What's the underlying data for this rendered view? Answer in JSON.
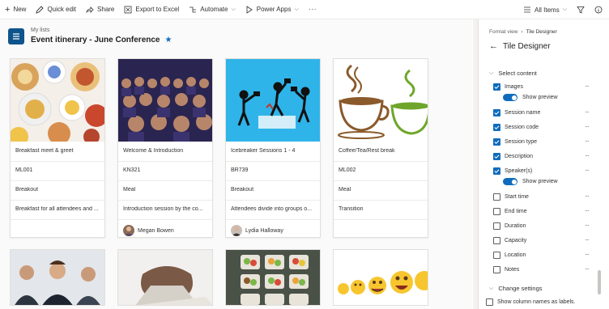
{
  "toolbar": {
    "new": "New",
    "quick_edit": "Quick edit",
    "share": "Share",
    "export": "Export to Excel",
    "automate": "Automate",
    "power_apps": "Power Apps",
    "more": "···",
    "view": "All Items"
  },
  "header": {
    "breadcrumb": "My lists",
    "title": "Event itinerary - June Conference"
  },
  "cards": [
    {
      "name": "Breakfast meet & greet",
      "code": "ML001",
      "type": "Breakout",
      "description": "Breakfast for all attendees and ...",
      "speaker": ""
    },
    {
      "name": "Welcome & Introduction",
      "code": "KN321",
      "type": "Meal",
      "description": "Introduction session by the co...",
      "speaker": "Megan Bowen"
    },
    {
      "name": "Icebreaker Sessions 1 - 4",
      "code": "BR739",
      "type": "Breakout",
      "description": "Attendees divide into groups o...",
      "speaker": "Lydia Halloway"
    },
    {
      "name": "Coffee/Tea/Rest break",
      "code": "ML002",
      "type": "Meal",
      "description": "Transition",
      "speaker": ""
    }
  ],
  "panel": {
    "breadcrumb_parent": "Format view",
    "breadcrumb_current": "Tile Designer",
    "title": "Tile Designer",
    "select_content": "Select content",
    "show_preview": "Show preview",
    "fields": [
      {
        "label": "Images",
        "checked": true
      },
      {
        "label": "Session name",
        "checked": true
      },
      {
        "label": "Session code",
        "checked": true
      },
      {
        "label": "Session type",
        "checked": true
      },
      {
        "label": "Description",
        "checked": true
      },
      {
        "label": "Speaker(s)",
        "checked": true
      },
      {
        "label": "Start time",
        "checked": false
      },
      {
        "label": "End time",
        "checked": false
      },
      {
        "label": "Duration",
        "checked": false
      },
      {
        "label": "Capacity",
        "checked": false
      },
      {
        "label": "Location",
        "checked": false
      },
      {
        "label": "Notes",
        "checked": false
      }
    ],
    "change_settings": "Change settings",
    "show_column_names": "Show column names as labels."
  },
  "colors": {
    "accent": "#0f6cbd",
    "list_icon": "#0f548c"
  }
}
